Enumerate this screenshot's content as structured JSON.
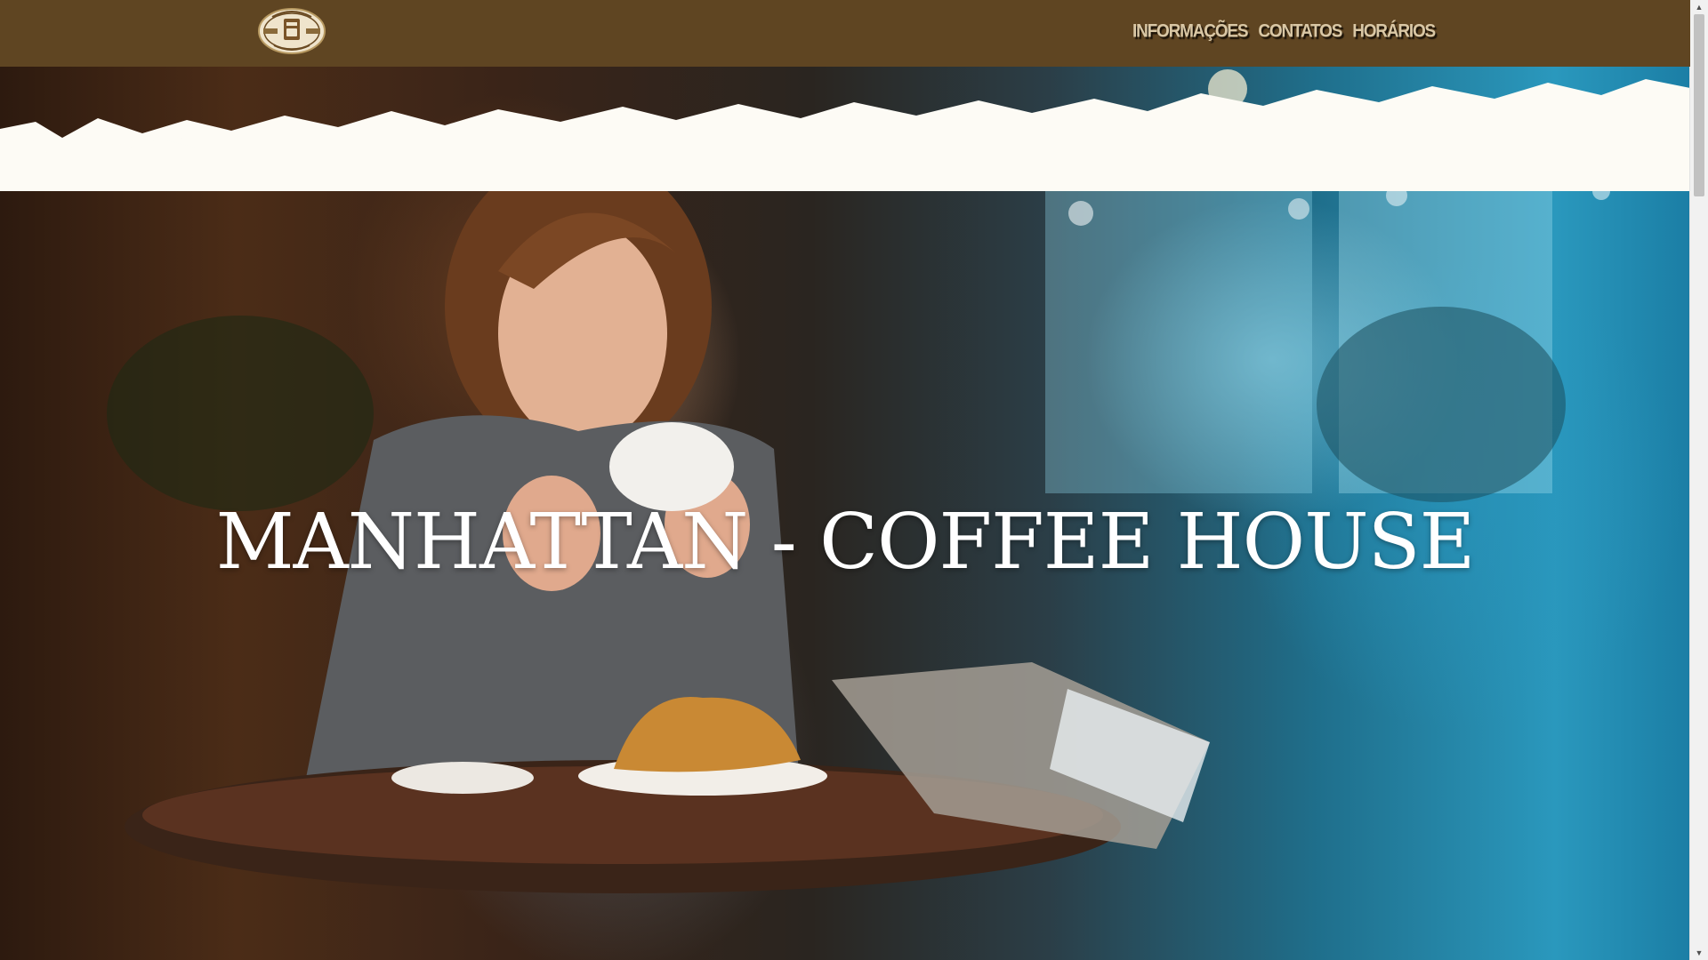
{
  "header": {
    "logo_icon": "coffee-emblem-logo",
    "nav": [
      {
        "label": "INFORMAÇÕES"
      },
      {
        "label": "CONTATOS"
      },
      {
        "label": "HORÁRIOS"
      }
    ]
  },
  "hero": {
    "title": "MANHATTAN - COFFEE HOUSE",
    "background_image": "woman-drinking-coffee-in-cafe-photo"
  },
  "colors": {
    "navbar_bg": "#5f4522",
    "nav_text": "#d9c7a5",
    "title_text": "#ffffff",
    "page_bg": "#fdfbf5"
  }
}
